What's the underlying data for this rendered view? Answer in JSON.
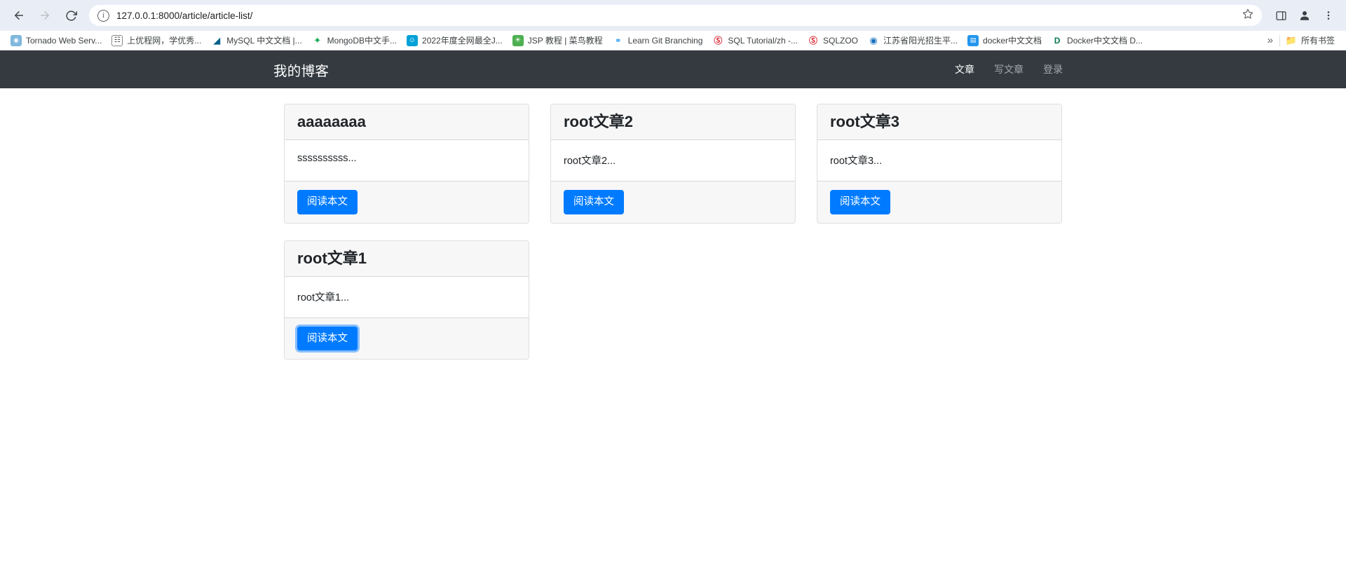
{
  "browser": {
    "back_tooltip": "Back",
    "forward_tooltip": "Forward",
    "reload_tooltip": "Reload",
    "url": "127.0.0.1:8000/article/article-list/",
    "bookmarks": [
      {
        "label": "Tornado Web Serv...",
        "icon": "tornado-icon",
        "color": "#7fb7dd",
        "glyph": "◕"
      },
      {
        "label": "上优程网，学优秀...",
        "icon": "book-icon",
        "color": "#ffffff",
        "glyph": "十"
      },
      {
        "label": "MySQL 中文文档 |...",
        "icon": "mysql-icon",
        "color": "#00618a",
        "glyph": "◥"
      },
      {
        "label": "MongoDB中文手...",
        "icon": "mongodb-icon",
        "color": "#ffffff",
        "glyph": "◆"
      },
      {
        "label": "2022年度全网最全J...",
        "icon": "bilibili-icon",
        "color": "#00a1d6",
        "glyph": "□"
      },
      {
        "label": "JSP 教程 | 菜鸟教程",
        "icon": "runoob-icon",
        "color": "#4caf50",
        "glyph": "●"
      },
      {
        "label": "Learn Git Branching",
        "icon": "git-icon",
        "color": "#ffffff",
        "glyph": "⑂"
      },
      {
        "label": "SQL Tutorial/zh -...",
        "icon": "sql-tutorial-icon",
        "color": "#d9232e",
        "glyph": "Q"
      },
      {
        "label": "SQLZOO",
        "icon": "sqlzoo-icon",
        "color": "#d9232e",
        "glyph": "Q"
      },
      {
        "label": "江苏省阳光招生平...",
        "icon": "jiangsu-icon",
        "color": "#1a73c0",
        "glyph": "◉"
      },
      {
        "label": "docker中文文档",
        "icon": "docker-doc-icon",
        "color": "#2496ed",
        "glyph": "工"
      },
      {
        "label": "Docker中文文档 D...",
        "icon": "docker-icon",
        "color": "#ffffff",
        "glyph": "D"
      }
    ],
    "overflow_label": "»",
    "all_bookmarks_label": "所有书签"
  },
  "site": {
    "brand": "我的博客",
    "nav": [
      {
        "label": "文章",
        "active": true
      },
      {
        "label": "写文章",
        "active": false
      },
      {
        "label": "登录",
        "active": false
      }
    ]
  },
  "articles": [
    {
      "title": "aaaaaaaa",
      "excerpt": "ssssssssss...",
      "button_label": "阅读本文",
      "focused": false
    },
    {
      "title": "root文章2",
      "excerpt": "root文章2...",
      "button_label": "阅读本文",
      "focused": false
    },
    {
      "title": "root文章3",
      "excerpt": "root文章3...",
      "button_label": "阅读本文",
      "focused": false
    },
    {
      "title": "root文章1",
      "excerpt": "root文章1...",
      "button_label": "阅读本文",
      "focused": true
    }
  ],
  "colors": {
    "navbar_bg": "#343a40",
    "primary": "#007bff",
    "toolbar_bg": "#e9edf6",
    "card_header_bg": "#f7f7f7"
  }
}
